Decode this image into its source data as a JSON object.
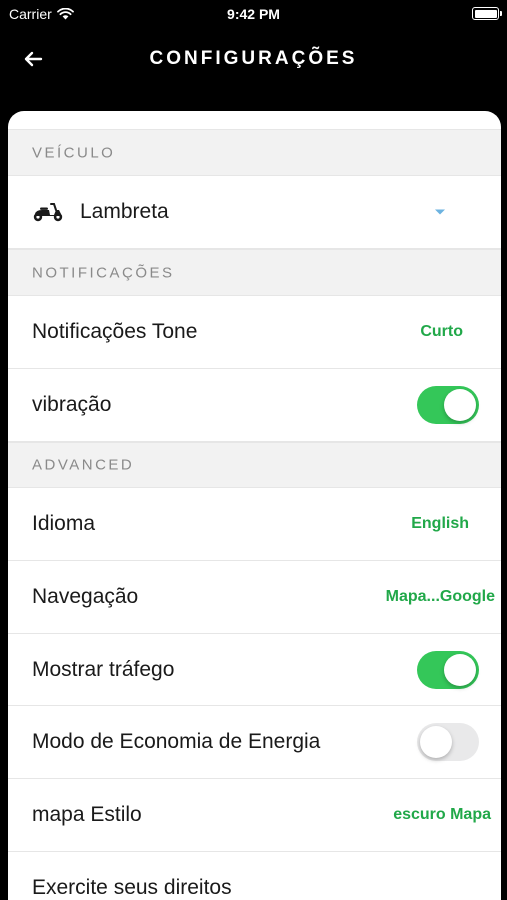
{
  "status_bar": {
    "carrier": "Carrier",
    "time": "9:42 PM",
    "icons": [
      "wifi-icon",
      "battery-icon"
    ]
  },
  "nav": {
    "title": "CONFIGURAÇÕES",
    "back_icon": "arrow-left-icon"
  },
  "sections": {
    "vehicle": {
      "header": "VEÍCULO",
      "selected_vehicle": "Lambreta",
      "vehicle_icon": "scooter-icon"
    },
    "notifications": {
      "header": "NOTIFICAÇÕES",
      "tone_label": "Notificações Tone",
      "tone_value": "Curto",
      "vibration_label": "vibração",
      "vibration_on": true
    },
    "advanced": {
      "header": "ADVANCED",
      "language_label": "Idioma",
      "language_value": "English",
      "navigation_label": "Navegação",
      "navigation_value": "Mapa...Google",
      "traffic_label": "Mostrar tráfego",
      "traffic_on": true,
      "power_saving_label": "Modo de Economia de Energia",
      "power_saving_on": false,
      "map_style_label": "mapa Estilo",
      "map_style_value": "escuro Mapa",
      "rights_label": "Exercite seus direitos"
    }
  },
  "colors": {
    "accent_green": "#21a849",
    "toggle_on": "#34c759",
    "toggle_off": "#e9e9ea",
    "header_bg": "#000000",
    "section_bg": "#f2f2f2",
    "dropdown_arrow": "#6db3e0"
  }
}
